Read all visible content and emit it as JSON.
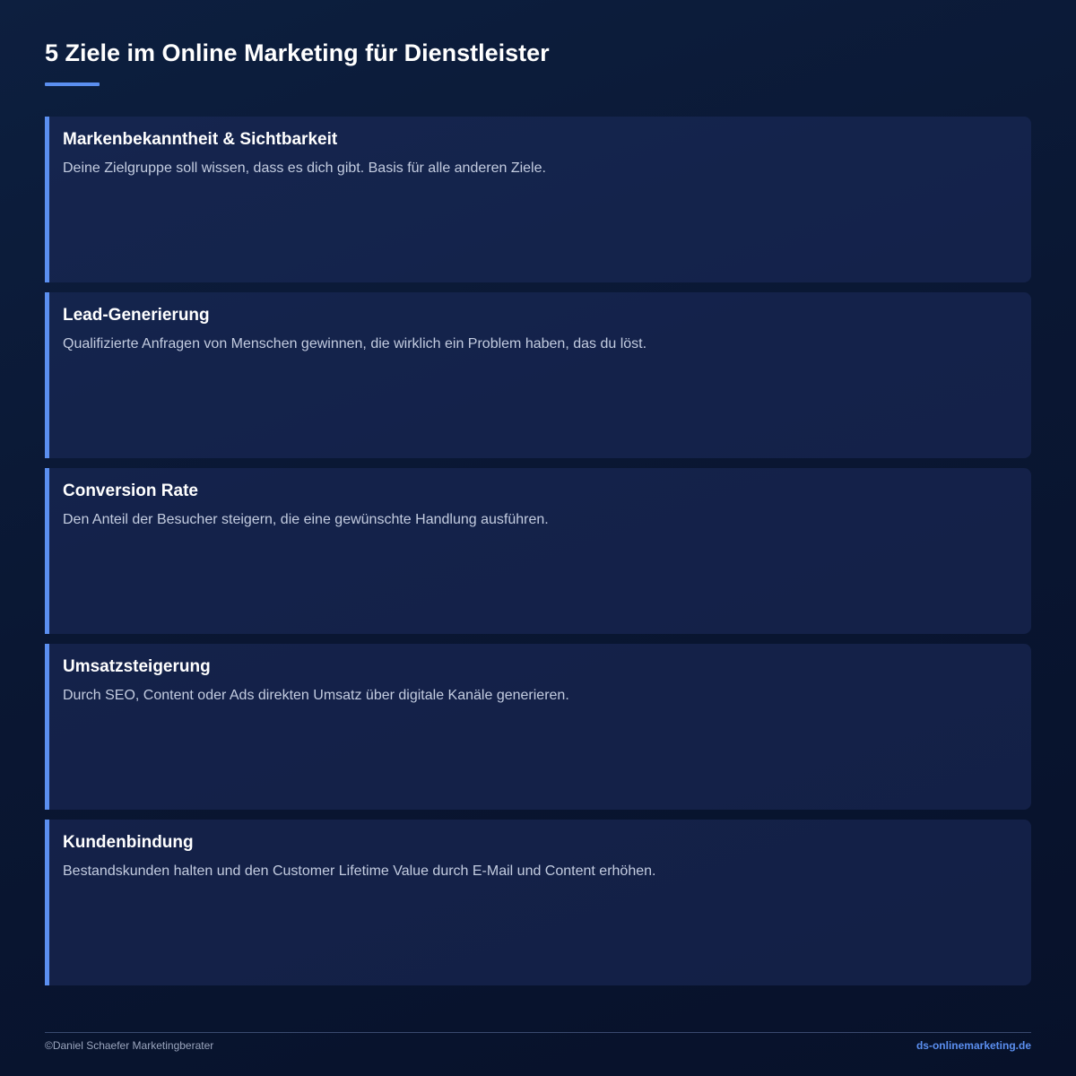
{
  "header": {
    "title": "5 Ziele im Online Marketing für Dienstleister"
  },
  "cards": [
    {
      "title": "Markenbekanntheit & Sichtbarkeit",
      "description": "Deine Zielgruppe soll wissen, dass es dich gibt. Basis für alle anderen Ziele."
    },
    {
      "title": "Lead-Generierung",
      "description": "Qualifizierte Anfragen von Menschen gewinnen, die wirklich ein Problem haben, das du löst."
    },
    {
      "title": "Conversion Rate",
      "description": "Den Anteil der Besucher steigern, die eine gewünschte Handlung ausführen."
    },
    {
      "title": "Umsatzsteigerung",
      "description": "Durch SEO, Content oder Ads direkten Umsatz über digitale Kanäle generieren."
    },
    {
      "title": "Kundenbindung",
      "description": "Bestandskunden halten und den Customer Lifetime Value durch E-Mail und Content erhöhen."
    }
  ],
  "footer": {
    "copyright": "©Daniel Schaefer Marketingberater",
    "website": "ds-onlinemarketing.de"
  },
  "colors": {
    "accent": "#5b8ff0",
    "background": "#0a1733",
    "card": "#1e2c5c"
  }
}
